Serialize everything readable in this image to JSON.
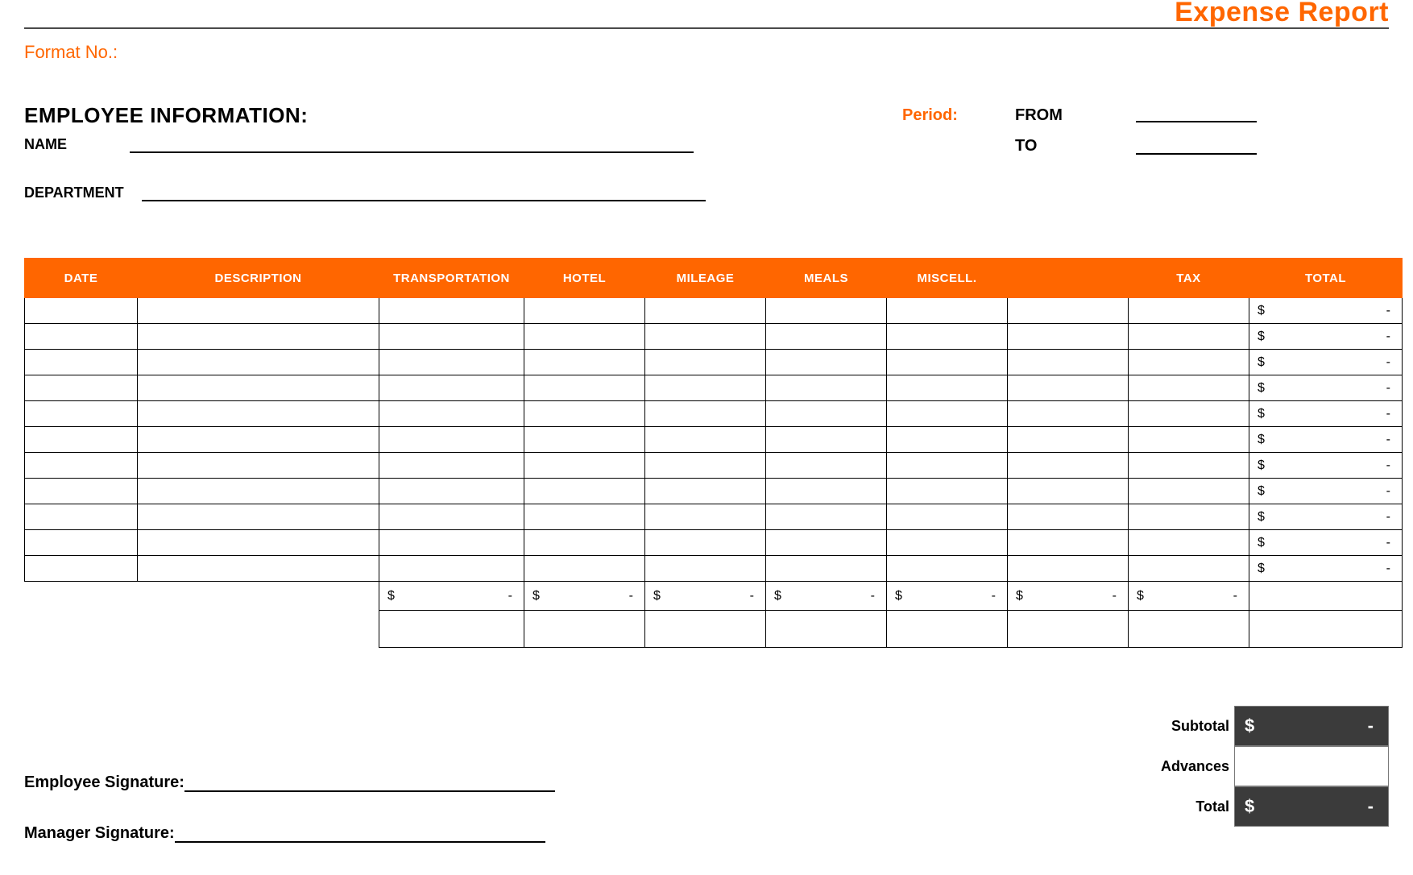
{
  "title": "Expense Report",
  "format_no_label": "Format No.:",
  "employee_info": {
    "heading": "EMPLOYEE INFORMATION:",
    "name_label": "NAME",
    "department_label": "DEPARTMENT",
    "period_label": "Period:",
    "from_label": "FROM",
    "to_label": "TO"
  },
  "table": {
    "headers": {
      "date": "DATE",
      "description": "DESCRIPTION",
      "transportation": "TRANSPORTATION",
      "hotel": "HOTEL",
      "mileage": "MILEAGE",
      "meals": "MEALS",
      "misc": "MISCELL.",
      "blank": "",
      "tax": "TAX",
      "total": "TOTAL"
    },
    "row_count": 11,
    "total_placeholder": {
      "currency": "$",
      "value": "-"
    },
    "column_sum_placeholder": {
      "currency": "$",
      "value": "-"
    }
  },
  "summary": {
    "subtotal_label": "Subtotal",
    "advances_label": "Advances",
    "total_label": "Total",
    "subtotal": {
      "currency": "$",
      "value": "-"
    },
    "total": {
      "currency": "$",
      "value": "-"
    }
  },
  "signatures": {
    "employee_label": "Employee Signature:",
    "manager_label": "Manager Signature:"
  },
  "chart_data": {
    "type": "table",
    "columns": [
      "DATE",
      "DESCRIPTION",
      "TRANSPORTATION",
      "HOTEL",
      "MILEAGE",
      "MEALS",
      "MISCELL.",
      "",
      "TAX",
      "TOTAL"
    ],
    "rows": [
      [
        "",
        "",
        "",
        "",
        "",
        "",
        "",
        "",
        "",
        "$ -"
      ],
      [
        "",
        "",
        "",
        "",
        "",
        "",
        "",
        "",
        "",
        "$ -"
      ],
      [
        "",
        "",
        "",
        "",
        "",
        "",
        "",
        "",
        "",
        "$ -"
      ],
      [
        "",
        "",
        "",
        "",
        "",
        "",
        "",
        "",
        "",
        "$ -"
      ],
      [
        "",
        "",
        "",
        "",
        "",
        "",
        "",
        "",
        "",
        "$ -"
      ],
      [
        "",
        "",
        "",
        "",
        "",
        "",
        "",
        "",
        "",
        "$ -"
      ],
      [
        "",
        "",
        "",
        "",
        "",
        "",
        "",
        "",
        "",
        "$ -"
      ],
      [
        "",
        "",
        "",
        "",
        "",
        "",
        "",
        "",
        "",
        "$ -"
      ],
      [
        "",
        "",
        "",
        "",
        "",
        "",
        "",
        "",
        "",
        "$ -"
      ],
      [
        "",
        "",
        "",
        "",
        "",
        "",
        "",
        "",
        "",
        "$ -"
      ],
      [
        "",
        "",
        "",
        "",
        "",
        "",
        "",
        "",
        "",
        "$ -"
      ]
    ],
    "column_sums": [
      "",
      "",
      "$ -",
      "$ -",
      "$ -",
      "$ -",
      "$ -",
      "$ -",
      "$ -",
      ""
    ],
    "subtotal": "$ -",
    "advances": "",
    "grand_total": "$ -"
  }
}
